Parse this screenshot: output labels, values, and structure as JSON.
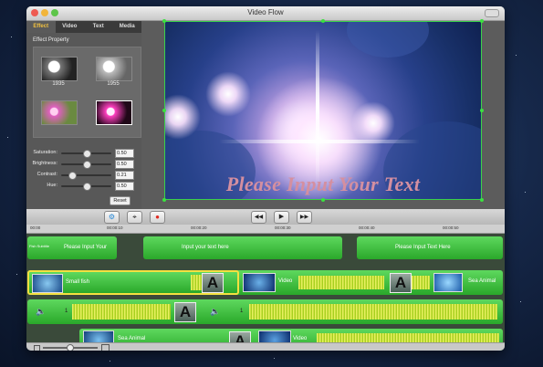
{
  "window": {
    "title": "Video Flow"
  },
  "effect_panel": {
    "tabs": [
      {
        "label": "Effect",
        "active": true
      },
      {
        "label": "Video",
        "active": false
      },
      {
        "label": "Text",
        "active": false
      },
      {
        "label": "Media",
        "active": false
      }
    ],
    "section_title": "Effect Property",
    "presets": [
      {
        "label": "1935"
      },
      {
        "label": "1955"
      },
      {
        "label": ""
      },
      {
        "label": ""
      }
    ],
    "properties": [
      {
        "label": "Saturation:",
        "value": "0.50",
        "level": 0.5
      },
      {
        "label": "Brightness:",
        "value": "0.50",
        "level": 0.5
      },
      {
        "label": "Contrast:",
        "value": "0.21",
        "level": 0.21
      },
      {
        "label": "Hue:",
        "value": "0.50",
        "level": 0.5
      }
    ],
    "reset_label": "Reset"
  },
  "preview": {
    "overlay_text": "Please Input Your Text"
  },
  "toolbar": {
    "left_buttons": [
      "gear-icon",
      "crop-icon",
      "record-icon"
    ],
    "transport": [
      "rewind-icon",
      "play-icon",
      "fast-forward-icon"
    ]
  },
  "timeline": {
    "ruler_ticks": [
      "00:00",
      "00:00:10",
      "00:00:20",
      "00:00:30",
      "00:00:40",
      "00:00:50"
    ],
    "text_track": [
      {
        "label": "Please Input Your"
      },
      {
        "label": "Input your text here"
      },
      {
        "label": "Please Input Text Here"
      }
    ],
    "text_track_prefix": "Fish Subtitle",
    "video_track": [
      {
        "label": "Small fish"
      },
      {
        "label": "Video"
      },
      {
        "label": "Sea Animal"
      }
    ],
    "audio_track": [
      {
        "label": "1"
      },
      {
        "label": "1"
      }
    ],
    "bottom_track": [
      {
        "label": "Sea Animal"
      },
      {
        "label": "Video"
      }
    ],
    "transition_glyph": "A"
  },
  "colors": {
    "track_green": "#3cc83c",
    "waveform_yellow": "#e0f050",
    "selection": "#3ad24a"
  }
}
